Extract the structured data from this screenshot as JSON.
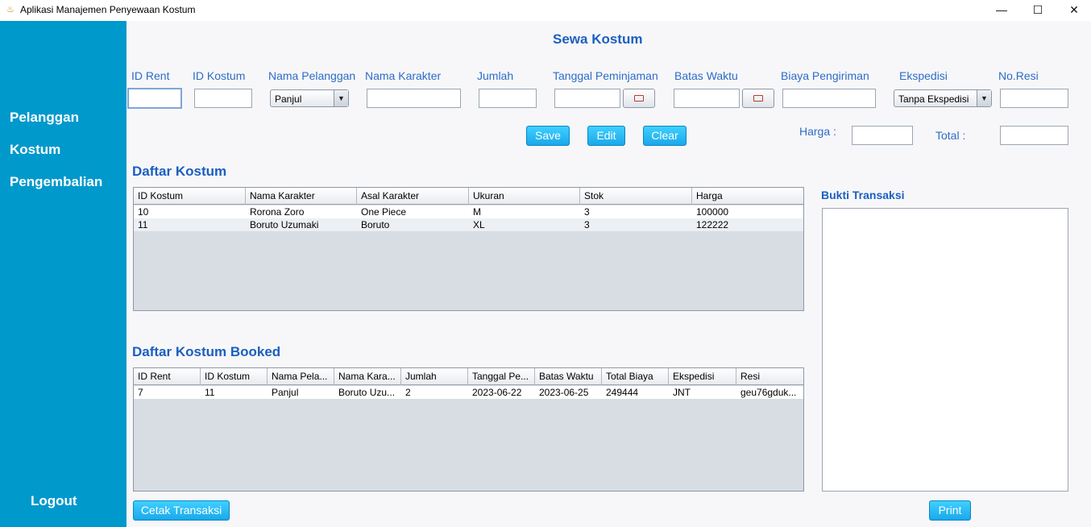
{
  "window": {
    "title": "Aplikasi Manajemen Penyewaan Kostum",
    "icon": "app-icon",
    "controls": {
      "minimize": "—",
      "maximize": "☐",
      "close": "✕"
    }
  },
  "sidebar": {
    "items": [
      {
        "label": "Pelanggan"
      },
      {
        "label": "Kostum"
      },
      {
        "label": "Pengembalian"
      }
    ],
    "logout": "Logout",
    "color": "#0099cc"
  },
  "form": {
    "title": "Sewa Kostum",
    "labels": {
      "id_rent": "ID Rent",
      "id_kostum": "ID Kostum",
      "nama_pelanggan": "Nama Pelanggan",
      "nama_karakter": "Nama Karakter",
      "jumlah": "Jumlah",
      "tanggal_peminjaman": "Tanggal Peminjaman",
      "batas_waktu": "Batas Waktu",
      "biaya_pengiriman": "Biaya Pengiriman",
      "ekspedisi": "Ekspedisi",
      "no_resi": "No.Resi",
      "harga": "Harga :",
      "total": "Total :"
    },
    "values": {
      "id_rent": "",
      "id_kostum": "",
      "nama_pelanggan": "Panjul",
      "nama_karakter": "",
      "jumlah": "",
      "tanggal_peminjaman": "",
      "batas_waktu": "",
      "biaya_pengiriman": "",
      "ekspedisi": "Tanpa Ekspedisi",
      "no_resi": "",
      "harga": "",
      "total": ""
    },
    "buttons": {
      "save": "Save",
      "edit": "Edit",
      "clear": "Clear"
    }
  },
  "daftar_kostum": {
    "title": "Daftar Kostum",
    "columns": [
      "ID Kostum",
      "Nama Karakter",
      "Asal Karakter",
      "Ukuran",
      "Stok",
      "Harga"
    ],
    "rows": [
      [
        "10",
        "Rorona Zoro",
        "One Piece",
        "M",
        "3",
        "100000"
      ],
      [
        "11",
        "Boruto Uzumaki",
        "Boruto",
        "XL",
        "3",
        "122222"
      ]
    ]
  },
  "daftar_booked": {
    "title": "Daftar Kostum Booked",
    "columns": [
      "ID Rent",
      "ID Kostum",
      "Nama Pela...",
      "Nama Kara...",
      "Jumlah",
      "Tanggal Pe...",
      "Batas Waktu",
      "Total Biaya",
      "Ekspedisi",
      "Resi"
    ],
    "rows": [
      [
        "7",
        "11",
        "Panjul",
        "Boruto Uzu...",
        "2",
        "2023-06-22",
        "2023-06-25",
        "249444",
        "JNT",
        "geu76gduk..."
      ]
    ]
  },
  "bukti": {
    "title": "Bukti Transaksi",
    "content": ""
  },
  "actions": {
    "cetak": "Cetak Transaksi",
    "print": "Print"
  }
}
